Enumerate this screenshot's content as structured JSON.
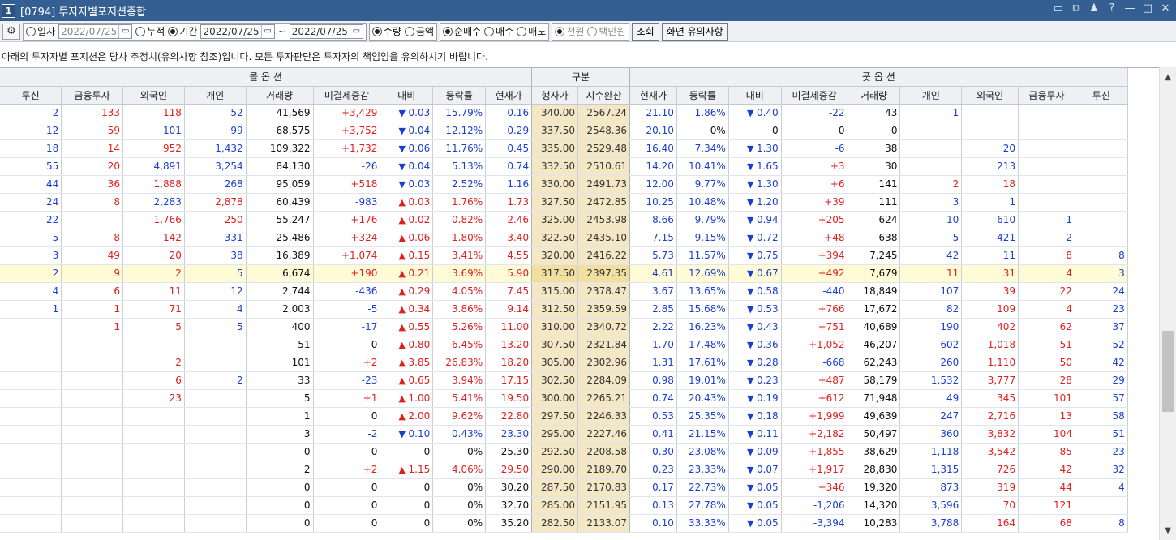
{
  "window": {
    "num": "1",
    "title": "[0794] 투자자별포지션종합",
    "buttons": [
      "▭",
      "⧉",
      "♟",
      "?",
      "—",
      "□",
      "✕"
    ]
  },
  "toolbar": {
    "gear": "⚙",
    "opt_day": "일자",
    "day_date": "2022/07/25",
    "opt_cum": "누적",
    "opt_period": "기간",
    "period_from": "2022/07/25",
    "tilde": "~",
    "period_to": "2022/07/25",
    "opt_qty": "수량",
    "opt_amt": "금액",
    "opt_net": "순매수",
    "opt_buy": "매수",
    "opt_sell": "매도",
    "opt_won": "천원",
    "opt_mil": "백만원",
    "query_btn": "조회",
    "notice_btn": "화면 유의사항"
  },
  "notice": "아래의 투자자별 포지션은 당사 추정치(유의사항 참조)입니다. 모든 투자판단은 투자자의 책임임을 유의하시기 바랍니다.",
  "grid": {
    "group_call": "콜 옵 션",
    "group_mid": "구분",
    "group_put": "풋 옵 션",
    "columns": [
      "투신",
      "금융투자",
      "외국인",
      "개인",
      "거래량",
      "미결제증감",
      "대비",
      "등락률",
      "현재가",
      "행사가",
      "지수환산",
      "현재가",
      "등락률",
      "대비",
      "미결제증감",
      "거래량",
      "개인",
      "외국인",
      "금융투자",
      "투신"
    ],
    "rows": [
      [
        "2",
        "133",
        "118",
        "52",
        "41,569",
        "+3,429",
        "▼",
        "0.03",
        "15.79%",
        "0.16",
        "340.00",
        "2567.24",
        "21.10",
        "1.86%",
        "▼",
        "0.40",
        "-22",
        "43",
        "1",
        "",
        ""
      ],
      [
        "12",
        "59",
        "101",
        "99",
        "68,575",
        "+3,752",
        "▼",
        "0.04",
        "12.12%",
        "0.29",
        "337.50",
        "2548.36",
        "20.10",
        "0%",
        "",
        "0",
        "0",
        "0",
        "",
        "",
        ""
      ],
      [
        "18",
        "14",
        "952",
        "1,432",
        "109,322",
        "+1,732",
        "▼",
        "0.06",
        "11.76%",
        "0.45",
        "335.00",
        "2529.48",
        "16.40",
        "7.34%",
        "▼",
        "1.30",
        "-6",
        "38",
        "",
        "20",
        ""
      ],
      [
        "55",
        "20",
        "4,891",
        "3,254",
        "84,130",
        "-26",
        "▼",
        "0.04",
        "5.13%",
        "0.74",
        "332.50",
        "2510.61",
        "14.20",
        "10.41%",
        "▼",
        "1.65",
        "+3",
        "30",
        "",
        "213",
        ""
      ],
      [
        "44",
        "36",
        "1,888",
        "268",
        "95,059",
        "+518",
        "▼",
        "0.03",
        "2.52%",
        "1.16",
        "330.00",
        "2491.73",
        "12.00",
        "9.77%",
        "▼",
        "1.30",
        "+6",
        "141",
        "2",
        "18",
        ""
      ],
      [
        "24",
        "8",
        "2,283",
        "2,878",
        "60,439",
        "-983",
        "▲",
        "0.03",
        "1.76%",
        "1.73",
        "327.50",
        "2472.85",
        "10.25",
        "10.48%",
        "▼",
        "1.20",
        "+39",
        "111",
        "3",
        "1",
        ""
      ],
      [
        "22",
        "",
        "1,766",
        "250",
        "55,247",
        "+176",
        "▲",
        "0.02",
        "0.82%",
        "2.46",
        "325.00",
        "2453.98",
        "8.66",
        "9.79%",
        "▼",
        "0.94",
        "+205",
        "624",
        "10",
        "610",
        "1"
      ],
      [
        "5",
        "8",
        "142",
        "331",
        "25,486",
        "+324",
        "▲",
        "0.06",
        "1.80%",
        "3.40",
        "322.50",
        "2435.10",
        "7.15",
        "9.15%",
        "▼",
        "0.72",
        "+48",
        "638",
        "5",
        "421",
        "2"
      ],
      [
        "3",
        "49",
        "20",
        "38",
        "16,389",
        "+1,074",
        "▲",
        "0.15",
        "3.41%",
        "4.55",
        "320.00",
        "2416.22",
        "5.73",
        "11.57%",
        "▼",
        "0.75",
        "+394",
        "7,245",
        "42",
        "11",
        "8"
      ],
      [
        "2",
        "9",
        "2",
        "5",
        "6,674",
        "+190",
        "▲",
        "0.21",
        "3.69%",
        "5.90",
        "317.50",
        "2397.35",
        "4.61",
        "12.69%",
        "▼",
        "0.67",
        "+492",
        "7,679",
        "11",
        "31",
        "4"
      ],
      [
        "4",
        "6",
        "11",
        "12",
        "2,744",
        "-436",
        "▲",
        "0.29",
        "4.05%",
        "7.45",
        "315.00",
        "2378.47",
        "3.67",
        "13.65%",
        "▼",
        "0.58",
        "-440",
        "18,849",
        "107",
        "39",
        "22"
      ],
      [
        "1",
        "1",
        "71",
        "4",
        "2,003",
        "-5",
        "▲",
        "0.34",
        "3.86%",
        "9.14",
        "312.50",
        "2359.59",
        "2.85",
        "15.68%",
        "▼",
        "0.53",
        "+766",
        "17,672",
        "82",
        "109",
        "4"
      ],
      [
        "",
        "1",
        "5",
        "5",
        "400",
        "-17",
        "▲",
        "0.55",
        "5.26%",
        "11.00",
        "310.00",
        "2340.72",
        "2.22",
        "16.23%",
        "▼",
        "0.43",
        "+751",
        "40,689",
        "190",
        "402",
        "62"
      ],
      [
        "",
        "",
        "",
        "",
        "51",
        "0",
        "▲",
        "0.80",
        "6.45%",
        "13.20",
        "307.50",
        "2321.84",
        "1.70",
        "17.48%",
        "▼",
        "0.36",
        "+1,052",
        "46,207",
        "602",
        "1,018",
        "51"
      ],
      [
        "",
        "",
        "2",
        "",
        "101",
        "+2",
        "▲",
        "3.85",
        "26.83%",
        "18.20",
        "305.00",
        "2302.96",
        "1.31",
        "17.61%",
        "▼",
        "0.28",
        "-668",
        "62,243",
        "260",
        "1,110",
        "50"
      ],
      [
        "",
        "",
        "6",
        "2",
        "33",
        "-23",
        "▲",
        "0.65",
        "3.94%",
        "17.15",
        "302.50",
        "2284.09",
        "0.98",
        "19.01%",
        "▼",
        "0.23",
        "+487",
        "58,179",
        "1,532",
        "3,777",
        "28"
      ],
      [
        "",
        "",
        "23",
        "",
        "5",
        "+1",
        "▲",
        "1.00",
        "5.41%",
        "19.50",
        "300.00",
        "2265.21",
        "0.74",
        "20.43%",
        "▼",
        "0.19",
        "+612",
        "71,948",
        "49",
        "345",
        "101"
      ],
      [
        "",
        "",
        "",
        "",
        "1",
        "0",
        "▲",
        "2.00",
        "9.62%",
        "22.80",
        "297.50",
        "2246.33",
        "0.53",
        "25.35%",
        "▼",
        "0.18",
        "+1,999",
        "49,639",
        "247",
        "2,716",
        "13"
      ],
      [
        "",
        "",
        "",
        "",
        "3",
        "-2",
        "▼",
        "0.10",
        "0.43%",
        "23.30",
        "295.00",
        "2227.46",
        "0.41",
        "21.15%",
        "▼",
        "0.11",
        "+2,182",
        "50,497",
        "360",
        "3,832",
        "104"
      ],
      [
        "",
        "",
        "",
        "",
        "0",
        "0",
        "",
        "0",
        "0%",
        "25.30",
        "292.50",
        "2208.58",
        "0.30",
        "23.08%",
        "▼",
        "0.09",
        "+1,855",
        "38,629",
        "1,118",
        "3,542",
        "85"
      ],
      [
        "",
        "",
        "",
        "",
        "2",
        "+2",
        "▲",
        "1.15",
        "4.06%",
        "29.50",
        "290.00",
        "2189.70",
        "0.23",
        "23.33%",
        "▼",
        "0.07",
        "+1,917",
        "28,830",
        "1,315",
        "726",
        "42"
      ],
      [
        "",
        "",
        "",
        "",
        "0",
        "0",
        "",
        "0",
        "0%",
        "30.20",
        "287.50",
        "2170.83",
        "0.17",
        "22.73%",
        "▼",
        "0.05",
        "+346",
        "19,320",
        "873",
        "319",
        "44"
      ],
      [
        "",
        "",
        "",
        "",
        "0",
        "0",
        "",
        "0",
        "0%",
        "32.70",
        "285.00",
        "2151.95",
        "0.13",
        "27.78%",
        "▼",
        "0.05",
        "-1,206",
        "14,320",
        "3,596",
        "70",
        "121"
      ],
      [
        "",
        "",
        "",
        "",
        "0",
        "0",
        "",
        "0",
        "0%",
        "35.20",
        "282.50",
        "2133.07",
        "0.10",
        "33.33%",
        "▼",
        "0.05",
        "-3,394",
        "10,283",
        "3,788",
        "164",
        "68"
      ]
    ],
    "put_tusin_tail": [
      "",
      "",
      "",
      "",
      "",
      "",
      "",
      "",
      "8",
      "3",
      "24",
      "23",
      "37",
      "52",
      "42",
      "29",
      "57",
      "58",
      "51",
      "23",
      "32",
      "4",
      "",
      "8"
    ],
    "highlight_row": 9
  },
  "scrollbar": {
    "up": "▲",
    "down": "▼"
  }
}
